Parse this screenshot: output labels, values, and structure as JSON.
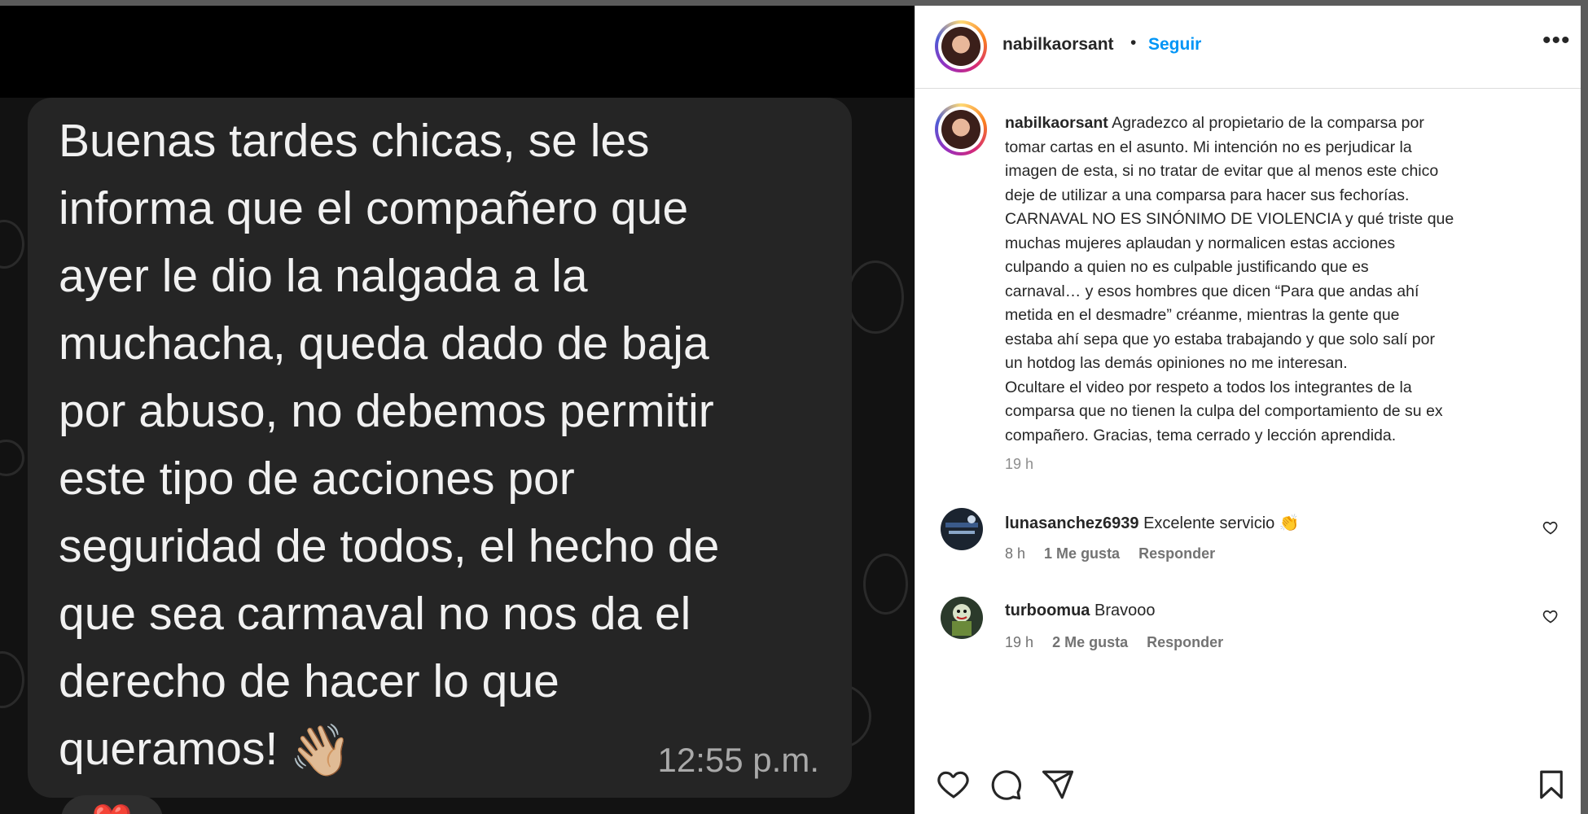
{
  "chat": {
    "message": "Buenas tardes chicas, se les\ninforma que el compañero que\nayer le dio la nalgada a la\nmuchacha, queda dado de baja\npor abuso, no debemos permitir\neste tipo de acciones por\nseguridad de todos, el hecho de\nque sea carmaval no nos da el\nderecho de hacer lo que\nqueramos!",
    "emoji": "👋🏼",
    "time": "12:55 p.m.",
    "reaction": "❤️"
  },
  "header": {
    "username": "nabilkaorsant",
    "separator": "•",
    "follow_label": "Seguir",
    "more_icon": "more-horizontal-icon"
  },
  "caption": {
    "username": "nabilkaorsant",
    "text": "Agradezco al propietario de la comparsa por\ntomar cartas en el asunto. Mi intención no es perjudicar la\nimagen de esta, si no tratar de evitar que al menos este chico\ndeje de utilizar a una comparsa para hacer sus fechorías.\nCARNAVAL NO ES SINÓNIMO DE VIOLENCIA y qué triste que\nmuchas mujeres aplaudan y normalicen estas acciones\nculpando a quien no es culpable justificando que es\ncarnaval… y esos hombres que dicen “Para que andas ahí\nmetida en el desmadre” créanme, mientras la gente que\nestaba ahí sepa que yo estaba trabajando y que solo salí por\nun hotdog las demás opiniones no me interesan.\nOcultare el video por respeto a todos los integrantes de la\ncomparsa que no tienen la culpa del comportamiento de su ex\ncompañero. Gracias, tema cerrado y lección aprendida.",
    "time": "19 h"
  },
  "comments": [
    {
      "username": "lunasanchez6939",
      "text": "Excelente servicio 👏",
      "time": "8 h",
      "likes": "1 Me gusta",
      "reply": "Responder"
    },
    {
      "username": "turboomua",
      "text": "Bravooo",
      "time": "19 h",
      "likes": "2 Me gusta",
      "reply": "Responder"
    }
  ],
  "actions": [
    "heart-icon",
    "comment-icon",
    "share-icon",
    "bookmark-icon"
  ],
  "colors": {
    "follow": "#0095f6",
    "chat_bubble": "#252525",
    "panel": "#ffffff"
  }
}
